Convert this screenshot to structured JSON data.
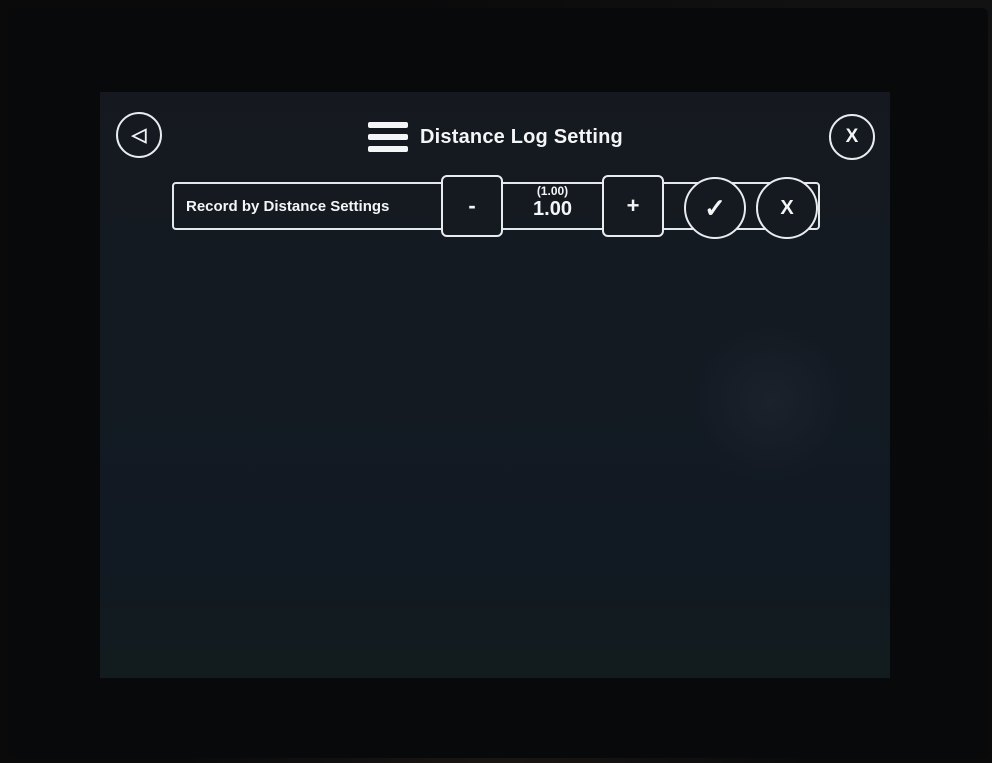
{
  "header": {
    "title": "Distance Log Setting",
    "back_icon": "◁",
    "close_label": "X"
  },
  "setting": {
    "label": "Record by Distance Settings",
    "decrement_label": "-",
    "increment_label": "+",
    "default_value": "(1.00)",
    "current_value": "1.00",
    "confirm_icon": "✓",
    "cancel_label": "X"
  },
  "colors": {
    "screen_background": "#141a22",
    "foreground": "#f3f5f6"
  },
  "icons": {
    "back": "back-triangle-icon",
    "menu": "hamburger-menu-icon",
    "confirm": "checkmark-icon"
  }
}
